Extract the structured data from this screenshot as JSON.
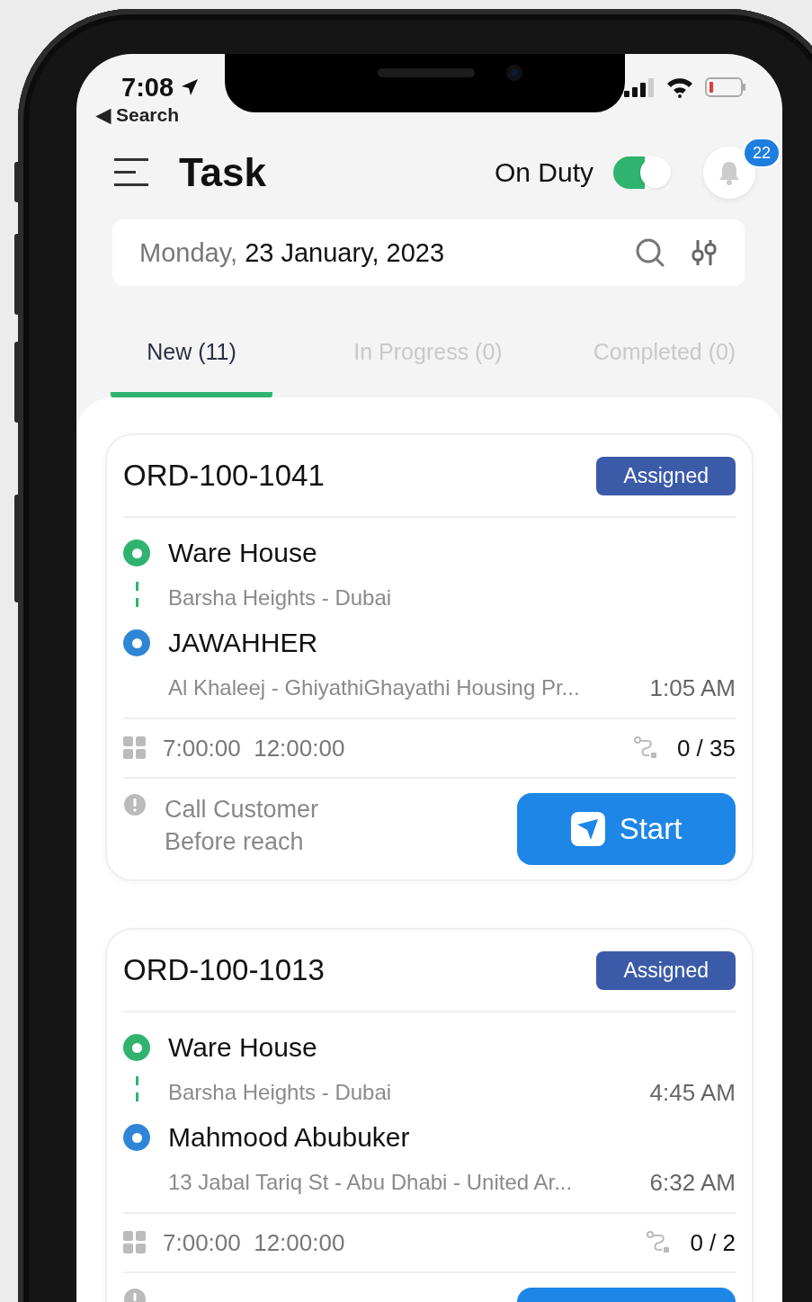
{
  "status_bar": {
    "time": "7:08",
    "back_link": {
      "arrow": "◀",
      "label": "Search"
    },
    "battery_low": true
  },
  "header": {
    "title": "Task",
    "duty": {
      "label": "On Duty",
      "on": true
    },
    "notifications": {
      "count": "22"
    }
  },
  "date_bar": {
    "weekday": "Monday,",
    "date": "23 January, 2023"
  },
  "tabs": [
    {
      "label": "New (11)",
      "selected": true
    },
    {
      "label": "In Progress (0)",
      "selected": false
    },
    {
      "label": "Completed (0)",
      "selected": false
    }
  ],
  "orders": [
    {
      "id": "ORD-100-1041",
      "status": "Assigned",
      "stops": [
        {
          "kind": "pickup",
          "name": "Ware House",
          "address": "Barsha Heights - Dubai"
        },
        {
          "kind": "dropoff",
          "name": "JAWAHHER",
          "address": "Al Khaleej - GhiyathiGhayathi Housing Pr...",
          "time": "1:05 AM"
        }
      ],
      "time_window": {
        "start": "7:00:00",
        "end": "12:00:00"
      },
      "items": "0 / 35",
      "note": [
        "Call Customer",
        "Before reach"
      ],
      "action": {
        "kind": "start",
        "label": "Start"
      }
    },
    {
      "id": "ORD-100-1013",
      "status": "Assigned",
      "stops": [
        {
          "kind": "pickup",
          "name": "Ware House",
          "address": "Barsha Heights - Dubai",
          "time": "4:45 AM"
        },
        {
          "kind": "dropoff",
          "name": "Mahmood Abubuker",
          "address": "13 Jabal Tariq St - Abu Dhabi - United Ar...",
          "time": "6:32 AM"
        }
      ],
      "time_window": {
        "start": "7:00:00",
        "end": "12:00:00"
      },
      "items": "0 / 2",
      "action": {
        "kind": "start"
      }
    }
  ]
}
